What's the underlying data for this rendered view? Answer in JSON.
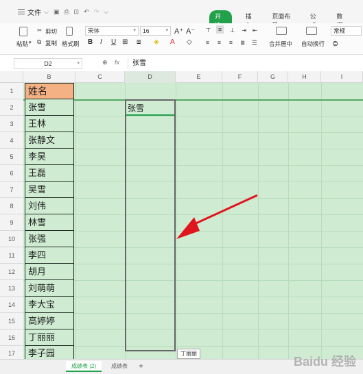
{
  "titlebar": {
    "file_label": "文件",
    "tabs": [
      "开始",
      "插入",
      "页面布局",
      "公式",
      "数据"
    ],
    "active_tab": "开始"
  },
  "ribbon": {
    "paste": "粘贴",
    "cut": "剪切",
    "copy": "复制",
    "format_painter": "格式刷",
    "font_name": "宋体",
    "font_size": "16",
    "merge": "合并居中",
    "wrap": "自动换行",
    "number_format": "常规",
    "bold": "B",
    "italic": "I",
    "underline": "U"
  },
  "formula_bar": {
    "cell_ref": "D2",
    "fx": "fx",
    "content": "张雪"
  },
  "columns": [
    "B",
    "C",
    "D",
    "E",
    "F",
    "G",
    "H",
    "I"
  ],
  "rows": [
    "1",
    "2",
    "3",
    "4",
    "5",
    "6",
    "7",
    "8",
    "9",
    "10",
    "11",
    "12",
    "13",
    "14",
    "15",
    "16",
    "17"
  ],
  "header_cell": "姓名",
  "names": [
    "张雪",
    "王林",
    "张静文",
    "李昊",
    "王磊",
    "吴雪",
    "刘伟",
    "林雪",
    "张强",
    "李四",
    "胡月",
    "刘萌萌",
    "李大宝",
    "高婷婷",
    "丁丽丽",
    "李子园"
  ],
  "d2_value": "张雪",
  "tooltip": "丁丽丽",
  "sheet_tabs": [
    "成绩表 (2)",
    "成绩表"
  ],
  "add_sheet": "+",
  "watermark": "Baidu 经验",
  "colors": {
    "accent": "#22a14a",
    "cell_fill": "#cfecd2",
    "header_fill": "#f4b183",
    "arrow": "#e0161f"
  }
}
